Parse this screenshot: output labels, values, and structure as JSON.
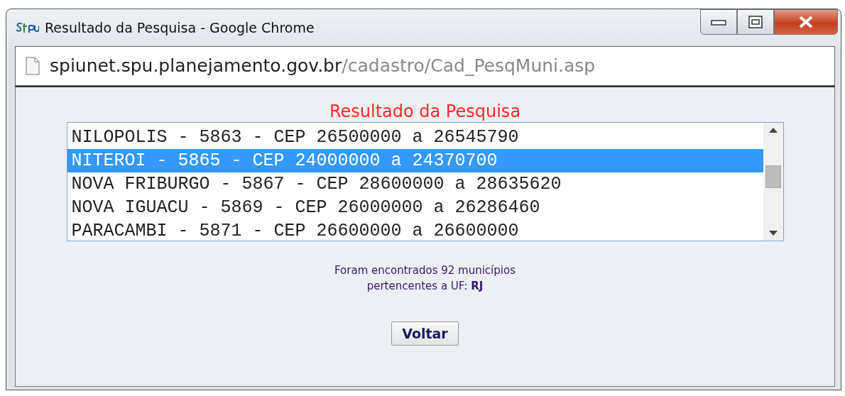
{
  "window": {
    "title": "Resultado da Pesquisa - Google Chrome"
  },
  "address": {
    "host": "spiunet.spu.planejamento.gov.br",
    "path": "/cadastro/Cad_PesqMuni.asp"
  },
  "heading": "Resultado da Pesquisa",
  "results": [
    {
      "label": "NILOPOLIS - 5863 - CEP 26500000 a 26545790",
      "selected": false
    },
    {
      "label": "NITEROI - 5865 - CEP 24000000 a 24370700",
      "selected": true
    },
    {
      "label": "NOVA FRIBURGO - 5867 - CEP 28600000 a 28635620",
      "selected": false
    },
    {
      "label": "NOVA IGUACU - 5869 - CEP 26000000 a 26286460",
      "selected": false
    },
    {
      "label": "PARACAMBI - 5871 - CEP 26600000 a 26600000",
      "selected": false
    }
  ],
  "summary": "Foram encontrados 92 municípios pertencentes a UF: **RJ**",
  "button": "Voltar"
}
